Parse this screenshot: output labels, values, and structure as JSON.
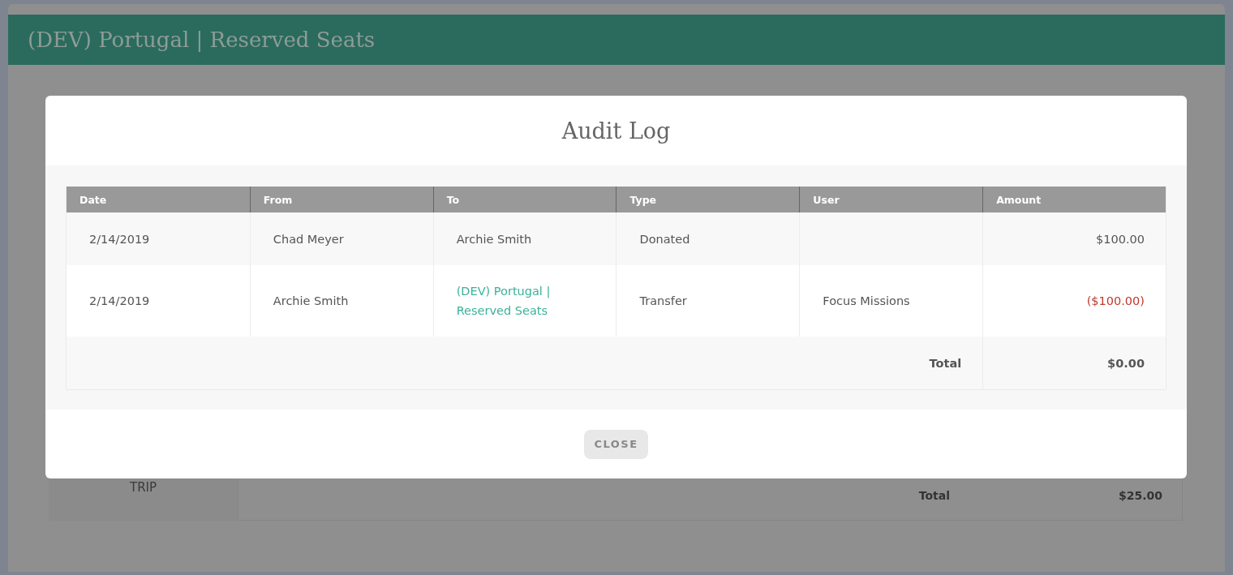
{
  "page": {
    "title": "(DEV) Portugal | Reserved Seats",
    "side_label": "TRIP",
    "total_label": "Total",
    "total_value": "$25.00"
  },
  "modal": {
    "title": "Audit Log",
    "columns": [
      "Date",
      "From",
      "To",
      "Type",
      "User",
      "Amount"
    ],
    "rows": [
      {
        "date": "2/14/2019",
        "from": "Chad Meyer",
        "to": "Archie Smith",
        "to_link": false,
        "type": "Donated",
        "amount": "$100.00",
        "negative": false
      },
      {
        "date": "2/14/2019",
        "from": "Archie Smith",
        "to": "(DEV) Portugal | Reserved Seats",
        "to_link": true,
        "type": "Transfer",
        "user": "Focus Missions",
        "amount": "($100.00)",
        "negative": true
      }
    ],
    "total_label": "Total",
    "total_value": "$0.00",
    "close_button": "CLOSE"
  }
}
